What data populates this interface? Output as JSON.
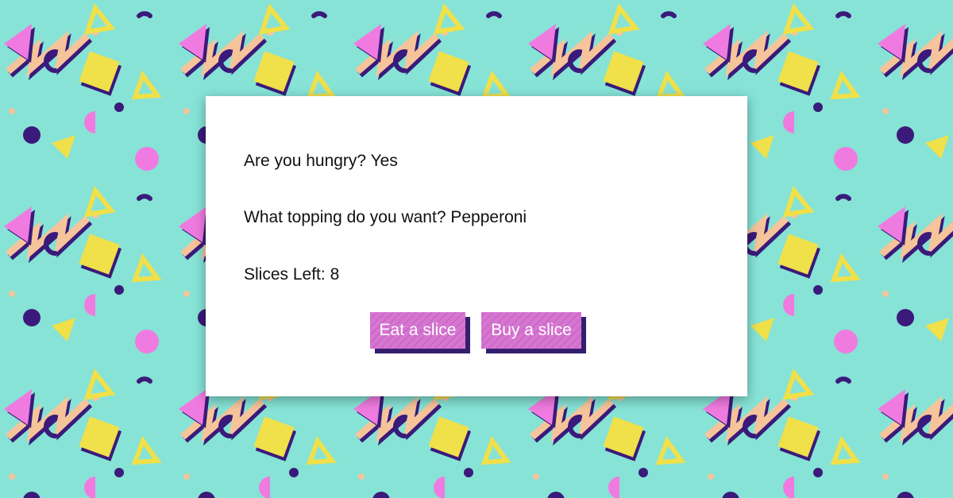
{
  "card": {
    "hungry_question": "Are you hungry?",
    "hungry_answer": "Yes",
    "topping_question": "What topping do you want?",
    "topping_answer": "Pepperoni",
    "slices_label": "Slices Left:",
    "slices_left": "8"
  },
  "buttons": {
    "eat_label": "Eat a slice",
    "buy_label": "Buy a slice"
  },
  "colors": {
    "background": "#86e3d6",
    "button": "#d56fd0",
    "button_shadow": "#2a1366"
  }
}
